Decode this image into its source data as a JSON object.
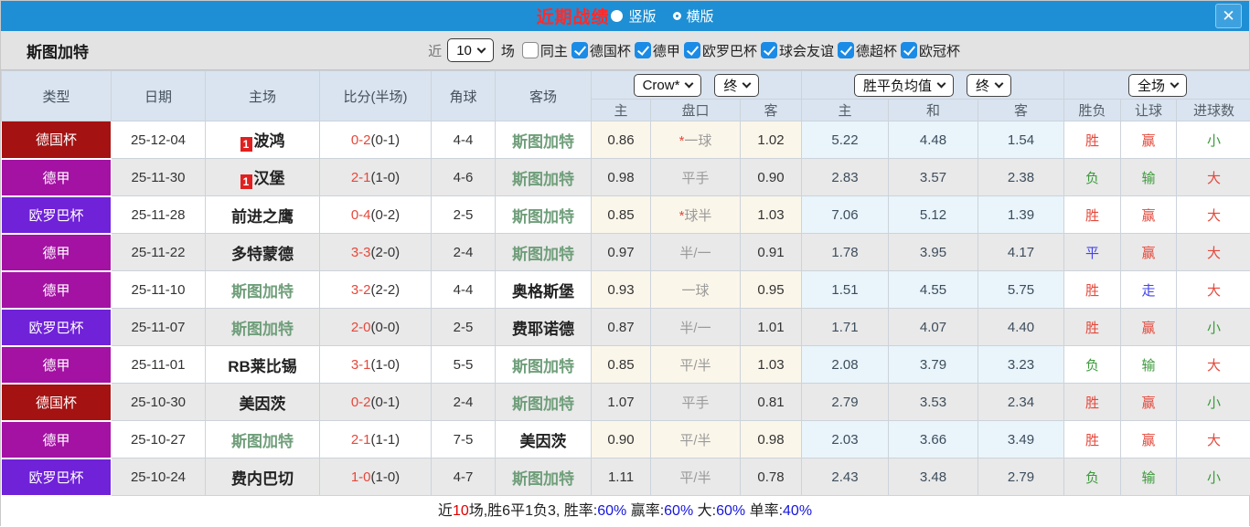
{
  "titlebar": {
    "title": "近期战绩",
    "close_glyph": "✕",
    "radios": [
      {
        "label": "竖版",
        "selected": true
      },
      {
        "label": "横版",
        "selected": false
      }
    ]
  },
  "filterbar": {
    "team": "斯图加特",
    "recent_label": "近",
    "recent_value": "10",
    "matches_label": "场",
    "same_home_label": "同主",
    "same_home_checked": false,
    "leagues": [
      {
        "label": "德国杯",
        "checked": true
      },
      {
        "label": "德甲",
        "checked": true
      },
      {
        "label": "欧罗巴杯",
        "checked": true
      },
      {
        "label": "球会友谊",
        "checked": true
      },
      {
        "label": "德超杯",
        "checked": true
      },
      {
        "label": "欧冠杯",
        "checked": true
      }
    ]
  },
  "table": {
    "headers": {
      "type": "类型",
      "date": "日期",
      "home": "主场",
      "score": "比分(半场)",
      "corners": "角球",
      "away": "客场",
      "crow_select": "Crow*",
      "crow_final_select": "终",
      "odds_sub": [
        "主",
        "盘口",
        "客"
      ],
      "europe_select": "胜平负均值",
      "europe_final_select": "终",
      "europe_sub": [
        "主",
        "和",
        "客"
      ],
      "fullmatch_select": "全场",
      "result_sub": [
        "胜负",
        "让球",
        "进球数"
      ]
    },
    "league_colors": {
      "德国杯": "#a41212",
      "德甲": "#a312a3",
      "欧罗巴杯": "#6f22d8"
    },
    "rows": [
      {
        "league": "德国杯",
        "date": "25-12-04",
        "home": {
          "name": "波鸿",
          "self": false,
          "badge": "1"
        },
        "score": {
          "ft": "0-2",
          "ht": "(0-1)"
        },
        "corners": "4-4",
        "away": {
          "name": "斯图加特",
          "self": true
        },
        "ah": {
          "home": "0.86",
          "star": true,
          "handicap": "一球",
          "away": "1.02"
        },
        "euro": [
          "5.22",
          "4.48",
          "1.54"
        ],
        "results": [
          {
            "text": "胜",
            "c": "red"
          },
          {
            "text": "赢",
            "c": "red"
          },
          {
            "text": "小",
            "c": "green"
          }
        ]
      },
      {
        "league": "德甲",
        "date": "25-11-30",
        "home": {
          "name": "汉堡",
          "self": false,
          "badge": "1"
        },
        "score": {
          "ft": "2-1",
          "ht": "(1-0)"
        },
        "corners": "4-6",
        "away": {
          "name": "斯图加特",
          "self": true
        },
        "ah": {
          "home": "0.98",
          "star": false,
          "handicap": "平手",
          "away": "0.90"
        },
        "euro": [
          "2.83",
          "3.57",
          "2.38"
        ],
        "results": [
          {
            "text": "负",
            "c": "green"
          },
          {
            "text": "输",
            "c": "green"
          },
          {
            "text": "大",
            "c": "red"
          }
        ]
      },
      {
        "league": "欧罗巴杯",
        "date": "25-11-28",
        "home": {
          "name": "前进之鹰",
          "self": false
        },
        "score": {
          "ft": "0-4",
          "ht": "(0-2)"
        },
        "corners": "2-5",
        "away": {
          "name": "斯图加特",
          "self": true
        },
        "ah": {
          "home": "0.85",
          "star": true,
          "handicap": "球半",
          "away": "1.03"
        },
        "euro": [
          "7.06",
          "5.12",
          "1.39"
        ],
        "results": [
          {
            "text": "胜",
            "c": "red"
          },
          {
            "text": "赢",
            "c": "red"
          },
          {
            "text": "大",
            "c": "red"
          }
        ]
      },
      {
        "league": "德甲",
        "date": "25-11-22",
        "home": {
          "name": "多特蒙德",
          "self": false
        },
        "score": {
          "ft": "3-3",
          "ht": "(2-0)"
        },
        "corners": "2-4",
        "away": {
          "name": "斯图加特",
          "self": true
        },
        "ah": {
          "home": "0.97",
          "star": false,
          "handicap": "半/一",
          "away": "0.91"
        },
        "euro": [
          "1.78",
          "3.95",
          "4.17"
        ],
        "results": [
          {
            "text": "平",
            "c": "blue"
          },
          {
            "text": "赢",
            "c": "red"
          },
          {
            "text": "大",
            "c": "red"
          }
        ]
      },
      {
        "league": "德甲",
        "date": "25-11-10",
        "home": {
          "name": "斯图加特",
          "self": true
        },
        "score": {
          "ft": "3-2",
          "ht": "(2-2)"
        },
        "corners": "4-4",
        "away": {
          "name": "奥格斯堡",
          "self": false
        },
        "ah": {
          "home": "0.93",
          "star": false,
          "handicap": "一球",
          "away": "0.95"
        },
        "euro": [
          "1.51",
          "4.55",
          "5.75"
        ],
        "results": [
          {
            "text": "胜",
            "c": "red"
          },
          {
            "text": "走",
            "c": "blue"
          },
          {
            "text": "大",
            "c": "red"
          }
        ]
      },
      {
        "league": "欧罗巴杯",
        "date": "25-11-07",
        "home": {
          "name": "斯图加特",
          "self": true
        },
        "score": {
          "ft": "2-0",
          "ht": "(0-0)"
        },
        "corners": "2-5",
        "away": {
          "name": "费耶诺德",
          "self": false
        },
        "ah": {
          "home": "0.87",
          "star": false,
          "handicap": "半/一",
          "away": "1.01"
        },
        "euro": [
          "1.71",
          "4.07",
          "4.40"
        ],
        "results": [
          {
            "text": "胜",
            "c": "red"
          },
          {
            "text": "赢",
            "c": "red"
          },
          {
            "text": "小",
            "c": "green"
          }
        ]
      },
      {
        "league": "德甲",
        "date": "25-11-01",
        "home": {
          "name": "RB莱比锡",
          "self": false
        },
        "score": {
          "ft": "3-1",
          "ht": "(1-0)"
        },
        "corners": "5-5",
        "away": {
          "name": "斯图加特",
          "self": true
        },
        "ah": {
          "home": "0.85",
          "star": false,
          "handicap": "平/半",
          "away": "1.03"
        },
        "euro": [
          "2.08",
          "3.79",
          "3.23"
        ],
        "results": [
          {
            "text": "负",
            "c": "green"
          },
          {
            "text": "输",
            "c": "green"
          },
          {
            "text": "大",
            "c": "red"
          }
        ]
      },
      {
        "league": "德国杯",
        "date": "25-10-30",
        "home": {
          "name": "美因茨",
          "self": false
        },
        "score": {
          "ft": "0-2",
          "ht": "(0-1)"
        },
        "corners": "2-4",
        "away": {
          "name": "斯图加特",
          "self": true
        },
        "ah": {
          "home": "1.07",
          "star": false,
          "handicap": "平手",
          "away": "0.81"
        },
        "euro": [
          "2.79",
          "3.53",
          "2.34"
        ],
        "results": [
          {
            "text": "胜",
            "c": "red"
          },
          {
            "text": "赢",
            "c": "red"
          },
          {
            "text": "小",
            "c": "green"
          }
        ]
      },
      {
        "league": "德甲",
        "date": "25-10-27",
        "home": {
          "name": "斯图加特",
          "self": true
        },
        "score": {
          "ft": "2-1",
          "ht": "(1-1)"
        },
        "corners": "7-5",
        "away": {
          "name": "美因茨",
          "self": false
        },
        "ah": {
          "home": "0.90",
          "star": false,
          "handicap": "平/半",
          "away": "0.98"
        },
        "euro": [
          "2.03",
          "3.66",
          "3.49"
        ],
        "results": [
          {
            "text": "胜",
            "c": "red"
          },
          {
            "text": "赢",
            "c": "red"
          },
          {
            "text": "大",
            "c": "red"
          }
        ]
      },
      {
        "league": "欧罗巴杯",
        "date": "25-10-24",
        "home": {
          "name": "费内巴切",
          "self": false
        },
        "score": {
          "ft": "1-0",
          "ht": "(1-0)"
        },
        "corners": "4-7",
        "away": {
          "name": "斯图加特",
          "self": true
        },
        "ah": {
          "home": "1.11",
          "star": false,
          "handicap": "平/半",
          "away": "0.78"
        },
        "euro": [
          "2.43",
          "3.48",
          "2.79"
        ],
        "results": [
          {
            "text": "负",
            "c": "green"
          },
          {
            "text": "输",
            "c": "green"
          },
          {
            "text": "小",
            "c": "green"
          }
        ]
      }
    ]
  },
  "footer": {
    "segments": [
      {
        "text": "近",
        "color": "#222222"
      },
      {
        "text": "10",
        "color": "#e00000"
      },
      {
        "text": "场,胜6平1负3, 胜率:",
        "color": "#222222"
      },
      {
        "text": "60%",
        "color": "#1515dd"
      },
      {
        "text": " 赢率:",
        "color": "#222222"
      },
      {
        "text": "60%",
        "color": "#1515dd"
      },
      {
        "text": " 大:",
        "color": "#222222"
      },
      {
        "text": "60%",
        "color": "#1515dd"
      },
      {
        "text": " 单率:",
        "color": "#222222"
      },
      {
        "text": "40%",
        "color": "#1515dd"
      }
    ]
  }
}
